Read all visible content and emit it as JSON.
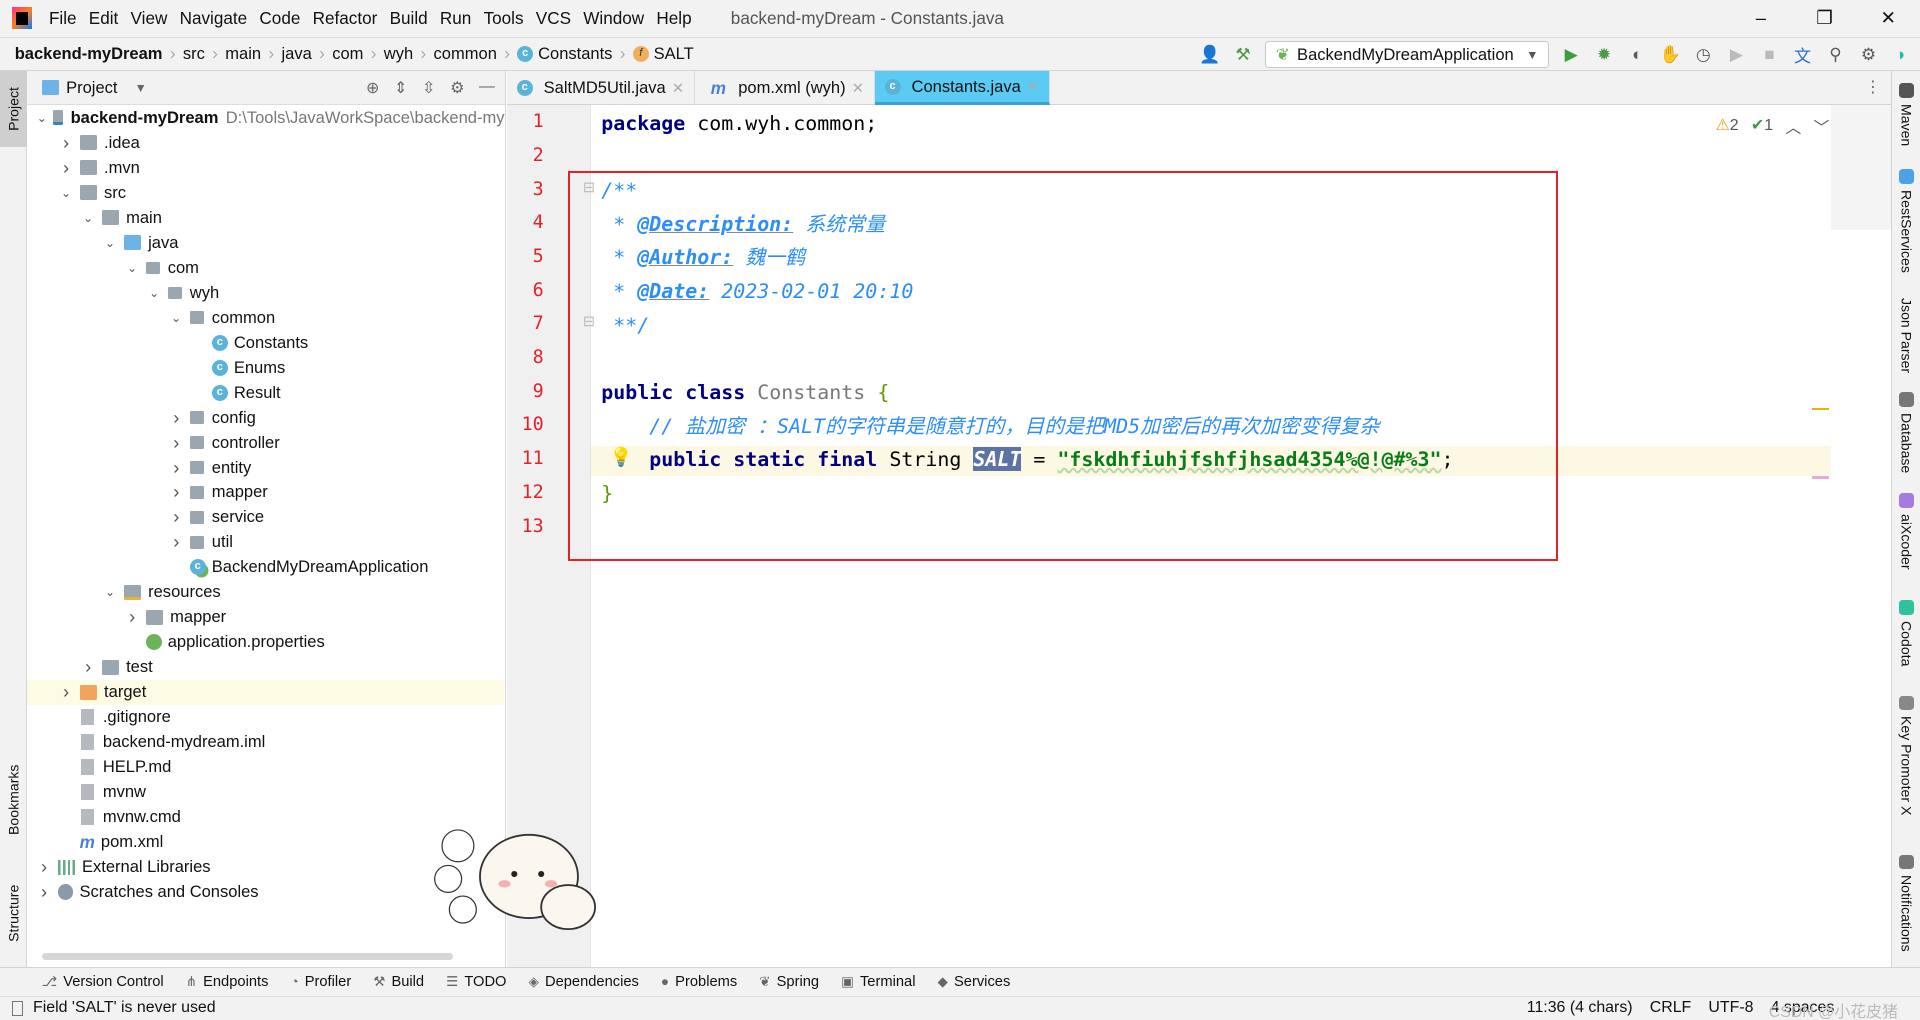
{
  "window": {
    "title": "backend-myDream - Constants.java",
    "controls": [
      "–",
      "❐",
      "✕"
    ]
  },
  "menu": [
    "File",
    "Edit",
    "View",
    "Navigate",
    "Code",
    "Refactor",
    "Build",
    "Run",
    "Tools",
    "VCS",
    "Window",
    "Help"
  ],
  "breadcrumb": [
    {
      "label": "backend-myDream",
      "icon": null
    },
    {
      "label": "src"
    },
    {
      "label": "main"
    },
    {
      "label": "java"
    },
    {
      "label": "com"
    },
    {
      "label": "wyh"
    },
    {
      "label": "common"
    },
    {
      "label": "Constants",
      "icon": "class-icon"
    },
    {
      "label": "SALT",
      "icon": "field-icon"
    }
  ],
  "toolbar": {
    "run_config": "BackendMyDreamApplication",
    "icons": [
      "user-icon",
      "build-hammer-icon",
      "run-icon",
      "debug-icon",
      "coverage-icon",
      "profile-icon",
      "run-with-icon",
      "resume-icon",
      "stop-icon",
      "translate-icon",
      "search-icon",
      "settings-icon",
      "toolbox-icon"
    ]
  },
  "left_strip": {
    "project": "Project",
    "bookmarks": "Bookmarks",
    "structure": "Structure"
  },
  "project_panel": {
    "title": "Project",
    "tree": [
      {
        "label": "backend-myDream",
        "path": "D:\\Tools\\JavaWorkSpace\\backend-my",
        "level": 0,
        "expand": "open",
        "icon": "module",
        "bold": true
      },
      {
        "label": ".idea",
        "level": 1,
        "expand": "closed",
        "icon": "folder"
      },
      {
        "label": ".mvn",
        "level": 1,
        "expand": "closed",
        "icon": "folder"
      },
      {
        "label": "src",
        "level": 1,
        "expand": "open",
        "icon": "folder"
      },
      {
        "label": "main",
        "level": 2,
        "expand": "open",
        "icon": "folder"
      },
      {
        "label": "java",
        "level": 3,
        "expand": "open",
        "icon": "source-folder"
      },
      {
        "label": "com",
        "level": 4,
        "expand": "open",
        "icon": "package"
      },
      {
        "label": "wyh",
        "level": 5,
        "expand": "open",
        "icon": "package"
      },
      {
        "label": "common",
        "level": 6,
        "expand": "open",
        "icon": "package"
      },
      {
        "label": "Constants",
        "level": 7,
        "icon": "class"
      },
      {
        "label": "Enums",
        "level": 7,
        "icon": "class"
      },
      {
        "label": "Result",
        "level": 7,
        "icon": "class"
      },
      {
        "label": "config",
        "level": 6,
        "expand": "closed",
        "icon": "package"
      },
      {
        "label": "controller",
        "level": 6,
        "expand": "closed",
        "icon": "package"
      },
      {
        "label": "entity",
        "level": 6,
        "expand": "closed",
        "icon": "package"
      },
      {
        "label": "mapper",
        "level": 6,
        "expand": "closed",
        "icon": "package"
      },
      {
        "label": "service",
        "level": 6,
        "expand": "closed",
        "icon": "package"
      },
      {
        "label": "util",
        "level": 6,
        "expand": "closed",
        "icon": "package"
      },
      {
        "label": "BackendMyDreamApplication",
        "level": 6,
        "icon": "spring-class"
      },
      {
        "label": "resources",
        "level": 3,
        "expand": "open",
        "icon": "resources-folder"
      },
      {
        "label": "mapper",
        "level": 4,
        "expand": "closed",
        "icon": "folder"
      },
      {
        "label": "application.properties",
        "level": 4,
        "icon": "properties"
      },
      {
        "label": "test",
        "level": 2,
        "expand": "closed",
        "icon": "folder"
      },
      {
        "label": "target",
        "level": 1,
        "expand": "closed",
        "icon": "excluded-folder",
        "selected": true
      },
      {
        "label": ".gitignore",
        "level": 1,
        "icon": "file"
      },
      {
        "label": "backend-mydream.iml",
        "level": 1,
        "icon": "file"
      },
      {
        "label": "HELP.md",
        "level": 1,
        "icon": "file"
      },
      {
        "label": "mvnw",
        "level": 1,
        "icon": "file"
      },
      {
        "label": "mvnw.cmd",
        "level": 1,
        "icon": "file"
      },
      {
        "label": "pom.xml",
        "level": 1,
        "icon": "maven"
      },
      {
        "label": "External Libraries",
        "level": 0,
        "expand": "closed",
        "icon": "libraries"
      },
      {
        "label": "Scratches and Consoles",
        "level": 0,
        "expand": "closed",
        "icon": "scratches"
      }
    ]
  },
  "tabs": [
    {
      "label": "SaltMD5Util.java",
      "icon": "class-icon",
      "active": false
    },
    {
      "label": "pom.xml (wyh)",
      "icon": "maven-icon",
      "active": false
    },
    {
      "label": "Constants.java",
      "icon": "class-icon",
      "active": true
    }
  ],
  "inspections": {
    "warnings": "2",
    "ok": "1"
  },
  "editor": {
    "current_line": 11,
    "lines": [
      [
        {
          "t": "package ",
          "c": "kw"
        },
        {
          "t": "com.wyh.common;",
          "c": "ident"
        }
      ],
      [],
      [
        {
          "t": "/**",
          "c": "doc"
        }
      ],
      [
        {
          "t": " * ",
          "c": "doc"
        },
        {
          "t": "@Description:",
          "c": "tag"
        },
        {
          "t": " 系统常量",
          "c": "doc"
        }
      ],
      [
        {
          "t": " * ",
          "c": "doc"
        },
        {
          "t": "@Author:",
          "c": "tag"
        },
        {
          "t": " 魏一鹤",
          "c": "doc"
        }
      ],
      [
        {
          "t": " * ",
          "c": "doc"
        },
        {
          "t": "@Date:",
          "c": "tag"
        },
        {
          "t": " 2023-02-01 20:10",
          "c": "doc"
        }
      ],
      [
        {
          "t": " **/",
          "c": "doc"
        }
      ],
      [],
      [
        {
          "t": "public class ",
          "c": "kw"
        },
        {
          "t": "Constants ",
          "c": "cls"
        },
        {
          "t": "{",
          "c": "brace"
        }
      ],
      [
        {
          "t": "    // 盐加密 ：SALT的字符串是随意打的，目的是把MD5加密后的再次加密变得复杂",
          "c": "cmt"
        }
      ],
      [
        {
          "t": "    public static final ",
          "c": "kw"
        },
        {
          "t": "String ",
          "c": "ident"
        },
        {
          "t": "SALT",
          "c": "selsym"
        },
        {
          "t": " = ",
          "c": "ident"
        },
        {
          "t": "\"fskdhfiuhjfshfjhsad4354%@!@#%3\"",
          "c": "str"
        },
        {
          "t": ";",
          "c": "ident"
        }
      ],
      [
        {
          "t": "}",
          "c": "brace"
        }
      ],
      []
    ]
  },
  "right_strip": [
    {
      "label": "Maven",
      "color": "#555555"
    },
    {
      "label": "RestServices",
      "color": "#4aa3e8"
    },
    {
      "label": "Json Parser",
      "color": null
    },
    {
      "label": "Database",
      "color": "#777777"
    },
    {
      "label": "aiXcoder",
      "color": "#a57be0"
    },
    {
      "label": "Codota",
      "color": "#2fc29b"
    },
    {
      "label": "Key Promoter X",
      "color": "#888888"
    },
    {
      "label": "Notifications",
      "color": "#777777"
    }
  ],
  "tool_windows": [
    {
      "label": "Version Control",
      "icon": "⎇"
    },
    {
      "label": "Endpoints",
      "icon": "⋔"
    },
    {
      "label": "Profiler",
      "icon": "◔"
    },
    {
      "label": "Build",
      "icon": "⚒"
    },
    {
      "label": "TODO",
      "icon": "☰"
    },
    {
      "label": "Dependencies",
      "icon": "◈"
    },
    {
      "label": "Problems",
      "icon": "●"
    },
    {
      "label": "Spring",
      "icon": "❦"
    },
    {
      "label": "Terminal",
      "icon": "▣"
    },
    {
      "label": "Services",
      "icon": "◆"
    }
  ],
  "status": {
    "message": "Field 'SALT' is never used",
    "position": "11:36 (4 chars)",
    "line_sep": "CRLF",
    "encoding": "UTF-8",
    "indent": "4 spaces",
    "watermark": "CSDN @小花皮猪"
  }
}
